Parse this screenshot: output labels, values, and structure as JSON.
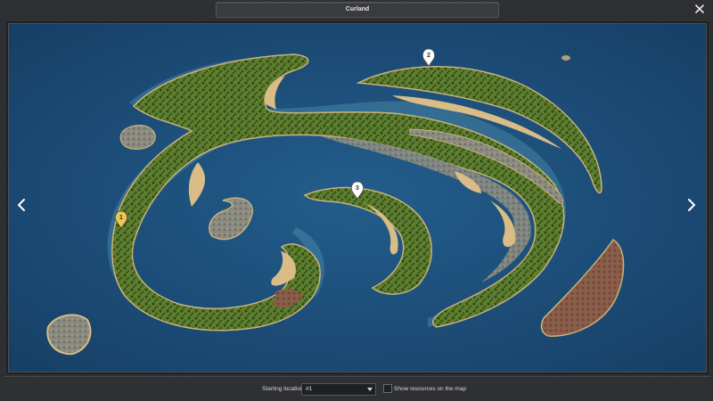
{
  "window": {
    "title": "Curland"
  },
  "map": {
    "markers": [
      {
        "label": "1",
        "color": "#e8c85a"
      },
      {
        "label": "2",
        "color": "#ffffff"
      },
      {
        "label": "3",
        "color": "#ffffff"
      }
    ]
  },
  "footer": {
    "starting_location_label": "Starting location",
    "starting_location_value": "#1",
    "show_resources_label": "Show resources on the map",
    "show_resources_checked": false
  },
  "colors": {
    "sea": "#1c4d78",
    "grass": "#5f7f2e",
    "sand": "#d9bc86",
    "rock": "#8a8a80",
    "marker_selected": "#e8c85a"
  }
}
